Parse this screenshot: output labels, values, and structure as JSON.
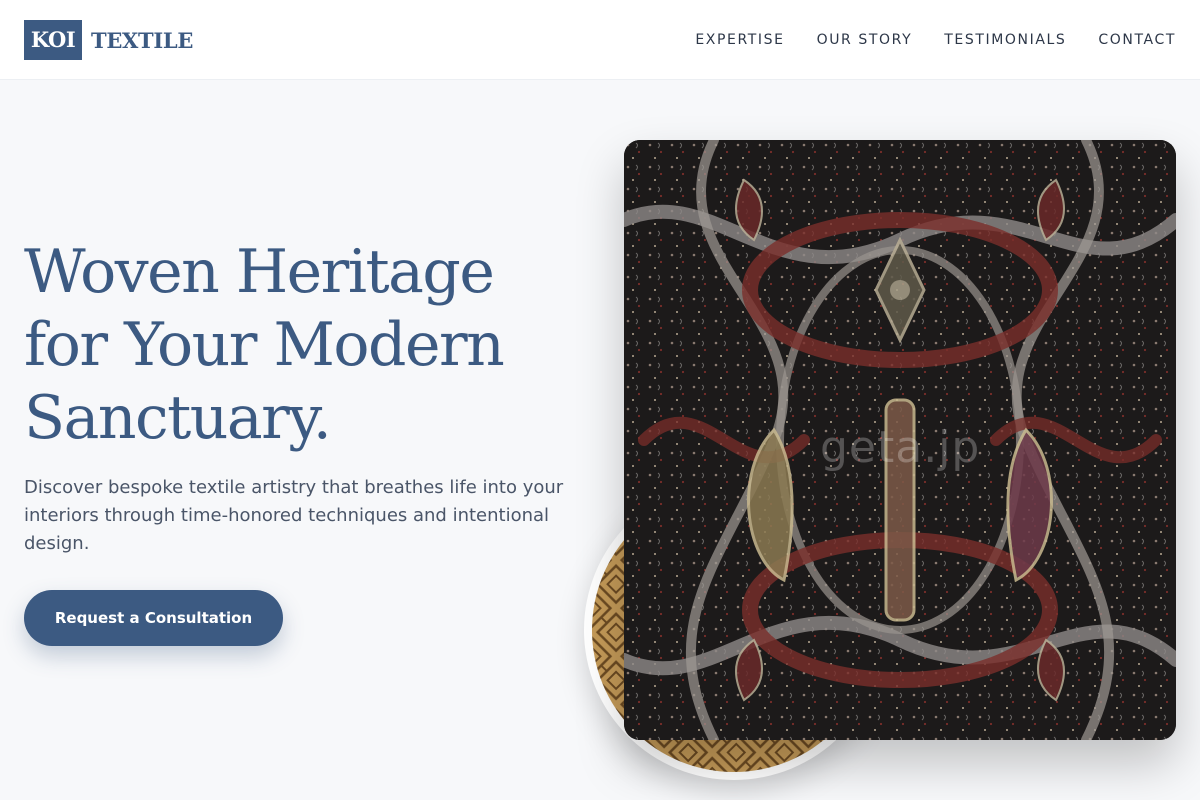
{
  "brand": {
    "mark": "KOI",
    "word": "TEXTILE"
  },
  "nav": {
    "items": [
      "EXPERTISE",
      "OUR STORY",
      "TESTIMONIALS",
      "CONTACT"
    ]
  },
  "hero": {
    "title_lines": [
      "Woven Heritage",
      "for Your Modern",
      "Sanctuary."
    ],
    "subtitle": "Discover bespoke textile artistry that breathes life into your interiors through time-honored techniques and intentional design.",
    "cta_label": "Request a Consultation"
  },
  "images": {
    "main": {
      "subject": "dark paisley woven shawl with red, cream and grey scrollwork",
      "watermark": "geta.jp"
    },
    "accent": {
      "subject": "golden geometric woven fabric"
    }
  },
  "colors": {
    "brand": "#3c5a82",
    "background": "#f7f8fa",
    "text": "#2d3748",
    "muted": "#4a5568"
  }
}
